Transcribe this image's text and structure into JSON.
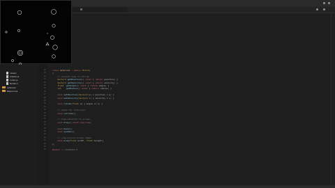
{
  "window": {
    "title": ""
  },
  "tabs": [
    {
      "label": ""
    }
  ],
  "sidebar": {
    "items": [
      {
        "label": "classic",
        "kind": "file"
      },
      {
        "label": "shader.js",
        "kind": "file"
      },
      {
        "label": "index.js",
        "kind": "file"
      },
      {
        "label": "Bullet.h",
        "kind": "file"
      },
      {
        "label": "Asteroid",
        "kind": "folder"
      },
      {
        "label": "Resources",
        "kind": "folder"
      }
    ]
  },
  "preview": {
    "name": "Asteroids game preview",
    "bg": "#030303",
    "stroke": "#d0d0d0"
  },
  "editor": {
    "lines": [
      {
        "num": "19",
        "html": "<span class='kw'>class</span> <span class='cls'>Asteroid</span> <span class='kw'>:</span> <span class='kw'>public</span> <span class='ty'>Entity</span>"
      },
      {
        "num": "20",
        "html": "{"
      },
      {
        "num": "21",
        "html": "    <span class='cm'>// convert type to string</span>"
      },
      {
        "num": "22",
        "html": "    <span class='ty'>Vector2</span> <span class='fn'>getPosition</span>() <span class='kw'>const</span> { <span class='kw'>return</span> position; }"
      },
      {
        "num": "23",
        "html": "    <span class='ty'>Vector2</span> <span class='fn'>getVelocity</span>() <span class='kw'>const</span> { <span class='kw'>return</span> velocity; }"
      },
      {
        "num": "24",
        "html": "    <span class='ty'>float</span>  <span class='fn'>getAngle</span>() <span class='kw'>const</span> { <span class='kw'>return</span> angle; }"
      },
      {
        "num": "25",
        "html": "    <span class='ty'>int</span>    <span class='fn'>getRadius</span>() <span class='kw'>const</span> { <span class='kw'>return</span> radius; }"
      },
      {
        "num": "26",
        "html": ""
      },
      {
        "num": "27",
        "html": "    <span class='kw'>void</span> <span class='fn'>setPosition</span>(<span class='ty'>Vector2</span> p) { position = p; }"
      },
      {
        "num": "28",
        "html": "    <span class='kw'>void</span> <span class='fn'>setVelocity</span>(<span class='ty'>Vector2</span> v) { velocity = v; }"
      },
      {
        "num": "29",
        "html": ""
      },
      {
        "num": "30",
        "html": "    <span class='kw'>void</span> <span class='fn'>rotate</span>(<span class='ty'>float</span> a) { angle += a; }"
      },
      {
        "num": "31",
        "html": ""
      },
      {
        "num": "32",
        "html": "    <span class='cm'>// check for collision</span>"
      },
      {
        "num": "33",
        "html": "    <span class='kw'>void</span> <span class='fn'>collide</span>();"
      },
      {
        "num": "34",
        "html": ""
      },
      {
        "num": "35",
        "html": "    <span class='cm'>// draw asteroid to screen</span>"
      },
      {
        "num": "36",
        "html": "    <span class='kw'>void</span> <span class='fn'>draw</span>() <span class='kw'>const</span> <span class='kw'>override</span>;"
      },
      {
        "num": "37",
        "html": ""
      },
      {
        "num": "38",
        "html": "    <span class='kw'>void</span> <span class='fn'>move</span>();"
      },
      {
        "num": "39",
        "html": "    <span class='kw'>void</span> <span class='fn'>update</span>();"
      },
      {
        "num": "40",
        "html": ""
      },
      {
        "num": "41",
        "html": "    <span class='cm'>// wrap around screen edges</span>"
      },
      {
        "num": "42",
        "html": "    <span class='kw'>void</span> <span class='fn'>wrap</span>(<span class='ty'>float</span> width, <span class='ty'>float</span> height);"
      },
      {
        "num": "43",
        "html": "};"
      },
      {
        "num": "44",
        "html": ""
      },
      {
        "num": "45",
        "html": "<span class='kw'>#endif</span> <span class='cm'>// ASTEROID_H</span>"
      }
    ]
  },
  "status": {
    "left": "",
    "right": ""
  }
}
